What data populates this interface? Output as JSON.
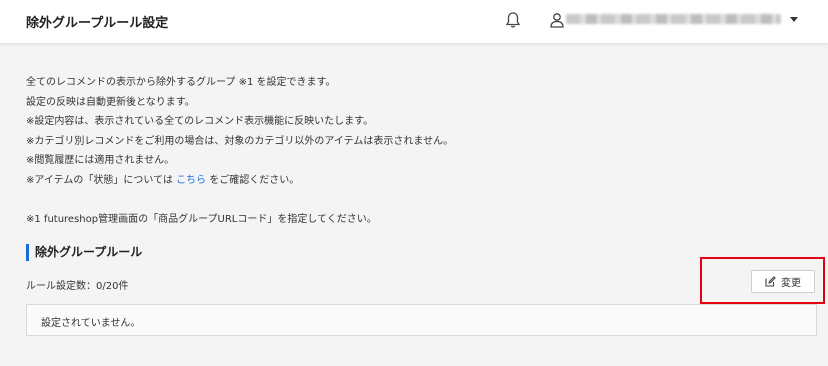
{
  "header": {
    "title": "除外グループルール設定",
    "bell_icon": "bell-icon",
    "user_icon": "user-icon",
    "user_menu_caret": "caret-down-icon"
  },
  "info": {
    "lines": [
      "全てのレコメンドの表示から除外するグループ ※1 を設定できます。",
      "設定の反映は自動更新後となります。",
      "※設定内容は、表示されている全てのレコメンド表示機能に反映いたします。",
      "※カテゴリ別レコメンドをご利用の場合は、対象のカテゴリ以外のアイテムは表示されません。",
      "※閲覧履歴には適用されません。"
    ],
    "item_status_prefix": "※アイテムの「状態」については ",
    "item_status_link": "こちら",
    "item_status_suffix": " をご確認ください。",
    "footnote": "※1 futureshop管理画面の「商品グループURLコード」を指定してください。"
  },
  "section": {
    "title": "除外グループルール",
    "rule_count": "ルール設定数：0/20件",
    "change_button": "変更",
    "change_icon": "edit-icon",
    "empty_message": "設定されていません。"
  },
  "colors": {
    "accent": "#1a6fd6",
    "link": "#1a73e8",
    "highlight": "#e60012",
    "background": "#f4f4f4"
  }
}
